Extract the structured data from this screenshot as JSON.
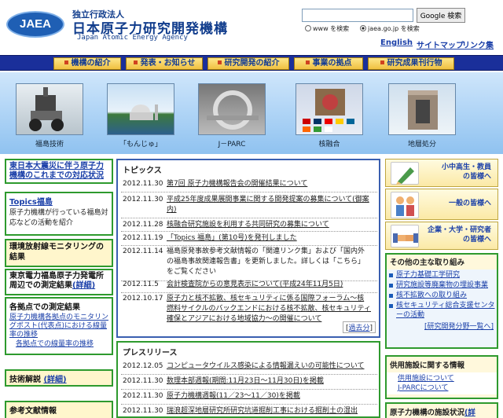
{
  "header": {
    "org_small": "独立行政法人",
    "org_name": "日本原子力研究開発機構",
    "org_english": "Japan Atomic Energy Agency",
    "logo_text": "JAEA",
    "search_placeholder": "",
    "search_button": "Google 検索",
    "radio_www": "www を検索",
    "radio_site": "jaea.go.jp を検索",
    "links": [
      "English",
      "サイトマップ",
      "リンク集"
    ]
  },
  "nav": [
    "機構の紹介",
    "発表・お知らせ",
    "研究開発の紹介",
    "事業の拠点",
    "研究成果刊行物"
  ],
  "photos": [
    "福島技術",
    "「もんじゅ」",
    "J－PARC",
    "核融合",
    "地層処分"
  ],
  "left": {
    "box1_title": "東日本大震災に伴う原子力機構のこれまでの対応状況",
    "box2_title": "Topics福島",
    "box2_body": "原子力機構が行っている福島対応などの活動を紹介",
    "box3_title": "環境放射線モニタリングの結果",
    "box4_title": "東京電力福島原子力発電所周辺での測定結果",
    "box4_link": "(詳細)",
    "box5_title": "各拠点での測定結果",
    "box5_link1": "原子力機構各拠点のモニタリングポスト(代表点)における線量率の推移",
    "box5_link2": "各拠点での線量率の推移",
    "box6_title": "技術解説",
    "box6_link": "(詳細)",
    "box7_title": "参考文献情報"
  },
  "topics": {
    "title": "トピックス",
    "items": [
      {
        "date": "2012.11.30",
        "text": "第7回 原子力機構報告会の開催結果について"
      },
      {
        "date": "2012.11.30",
        "text": "平成25年度成果展開事業に関する開発提案の募集について(御案内)"
      },
      {
        "date": "2012.11.28",
        "text": "核融合研究施設を利用する共同研究の募集について"
      },
      {
        "date": "2012.11.19",
        "text": "「Topics 福島」(第10号)を発刊しました"
      },
      {
        "date": "2012.11.14",
        "text": "福島原発事故参考文献情報の「関連リンク集」および「国内外の福島事故関連報告書」を更新しました。詳しくは「こちら」をご覧ください"
      },
      {
        "date": "2012.11.5",
        "text": "会計検査院からの意見表示について(平成24年11月5日)"
      },
      {
        "date": "2012.10.17",
        "text": "原子力と核不拡散、核セキュリティに係る国際フォーラム～核燃料サイクルのバックエンドにおける核不拡散、核セキュリティ確保とアジアにおける地域協力～の開催について"
      }
    ],
    "past": "過去分"
  },
  "press": {
    "title": "プレスリリース",
    "items": [
      {
        "date": "2012.12.05",
        "text": "コンピュータウイルス感染による情報漏えいの可能性について"
      },
      {
        "date": "2012.11.30",
        "text": "数理本部週報(期間:11月23日～11月30日)を掲載"
      },
      {
        "date": "2012.11.30",
        "text": "原子力機構週報(11／23～11／30)を掲載"
      },
      {
        "date": "2012.11.30",
        "text": "瑞浪超深地層研究所研究坑道掘削工事における掘削土の湿出"
      }
    ]
  },
  "right": {
    "btn1": [
      "小中高生・教員",
      "の皆様へ"
    ],
    "btn2": [
      "一般の皆様へ"
    ],
    "btn3": [
      "企業・大学・研究者",
      "の皆様へ"
    ],
    "other_title": "その他の主な取り組み",
    "other_items": [
      "原子力基礎工学研究",
      "研究施設等廃棄物の埋設事業",
      "核不拡散への取り組み",
      "核セキュリティ総合支援センターの活動"
    ],
    "other_link": "[研究開発分野一覧へ]",
    "facility_title": "供用施設に関する情報",
    "facility_items": [
      "供用施設について",
      "J-PARCについて"
    ],
    "facility_status": "原子力機構の施設状況",
    "facility_status_link": "(詳"
  }
}
